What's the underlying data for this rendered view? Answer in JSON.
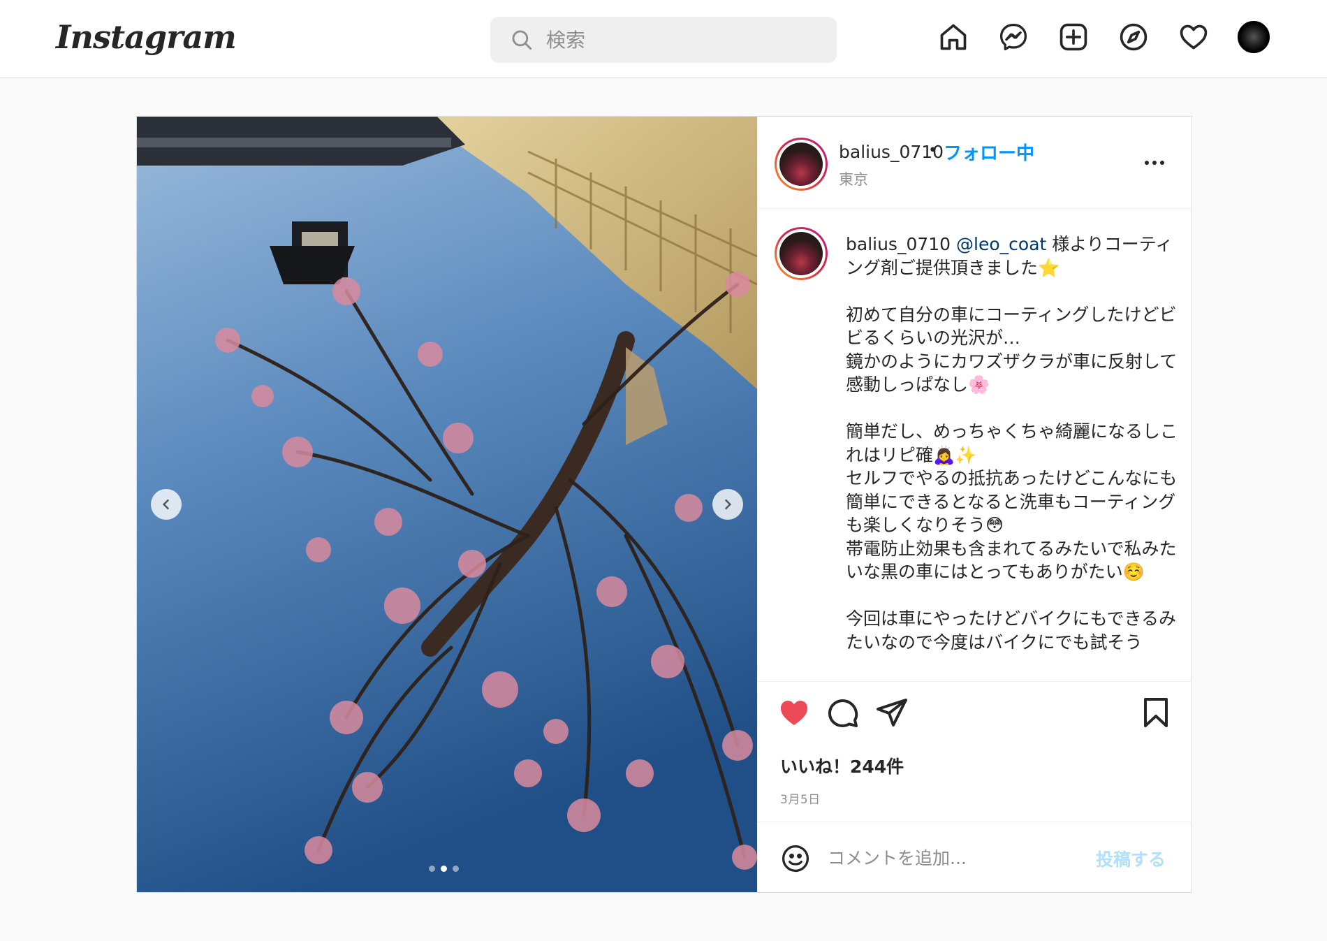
{
  "app": {
    "logo_text": "Instagram",
    "accent_color": "#0095f6"
  },
  "search": {
    "placeholder": "検索",
    "icon": "search-icon"
  },
  "nav": {
    "icons": [
      "home-icon",
      "messenger-icon",
      "new-post-icon",
      "explore-icon",
      "activity-heart-icon",
      "profile-avatar"
    ]
  },
  "post": {
    "username": "balius_0710",
    "separator": "•",
    "follow_label": "フォロー中",
    "location": "東京",
    "caption": {
      "username": "balius_0710",
      "mention": "@leo_coat",
      "text": " 様よりコーティング剤ご提供頂きました⭐\n\n初めて自分の車にコーティングしたけどビビるくらいの光沢が…\n鏡かのようにカワズザクラが車に反射して感動しっぱなし🌸\n\n簡単だし、めっちゃくちゃ綺麗になるしこれはリピ確🙇‍♀️✨\nセルフでやるの抵抗あったけどこんなにも簡単にできるとなると洗車もコーティングも楽しくなりそう😳\n帯電防止効果も含まれてるみたいで私みたいな黒の車にはとってもありがたい☺️\n\n今回は車にやったけどバイクにもできるみたいなので今度はバイクにでも試そう"
    },
    "likes_text": "いいね！244件",
    "date": "3月5日",
    "carousel": {
      "count": 3,
      "active_index": 1
    },
    "liked": true
  },
  "comment": {
    "placeholder": "コメントを追加...",
    "post_label": "投稿する"
  }
}
